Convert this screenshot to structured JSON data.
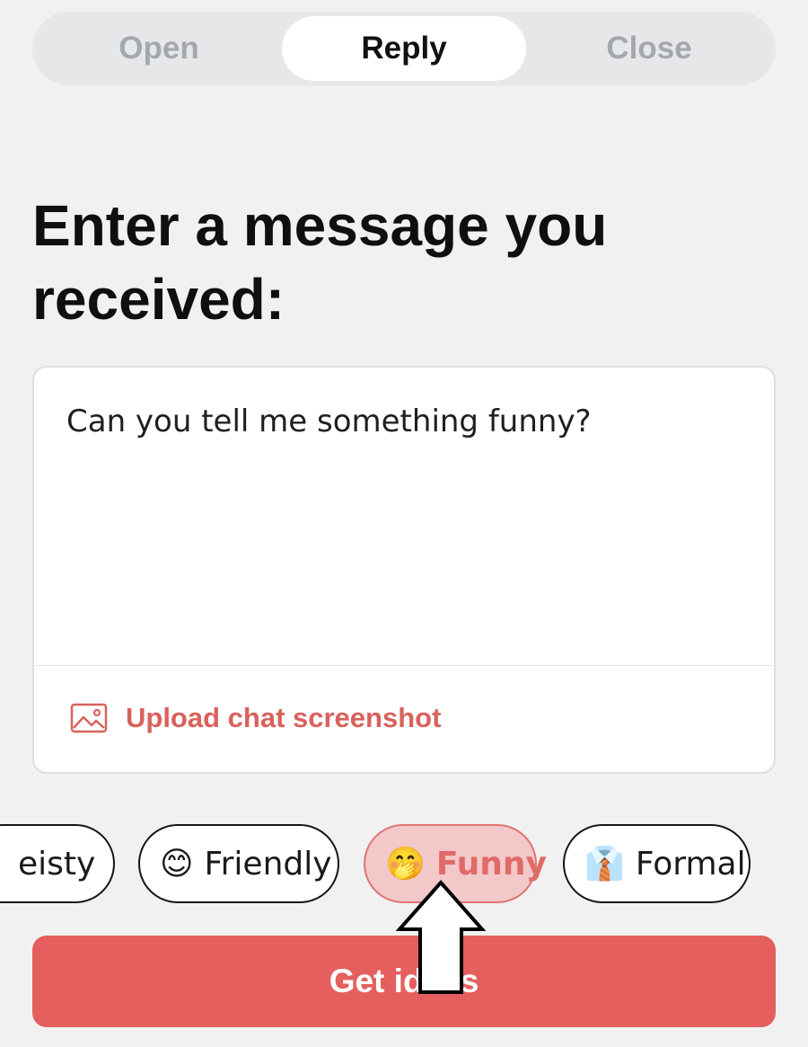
{
  "tabs": [
    {
      "label": "Open",
      "active": false
    },
    {
      "label": "Reply",
      "active": true
    },
    {
      "label": "Close",
      "active": false
    }
  ],
  "heading": "Enter a message you received:",
  "message": {
    "value": "Can you tell me something funny?"
  },
  "upload": {
    "label": "Upload chat screenshot",
    "icon": "image-icon"
  },
  "tones": [
    {
      "label": "eisty",
      "emoji": ""
    },
    {
      "label": "Friendly",
      "emoji": "😊"
    },
    {
      "label": "Funny",
      "emoji": "🤭",
      "selected": true
    },
    {
      "label": "Formal",
      "emoji": "👔"
    }
  ],
  "cta": {
    "label": "Get ideas"
  },
  "colors": {
    "accent": "#e55f5f",
    "accent_text": "#d9615d",
    "selected_chip_bg": "#f2c8c8",
    "page_bg": "#f1f1f1"
  }
}
